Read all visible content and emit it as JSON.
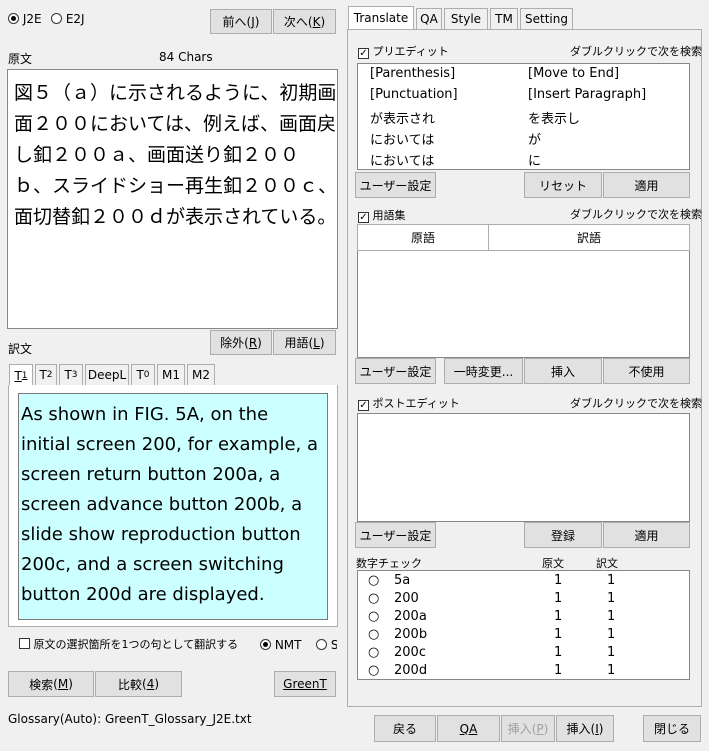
{
  "mode": {
    "j2e": "J2E",
    "e2j": "E2J"
  },
  "nav": {
    "prev": "前へ",
    "prev_key": "J",
    "next": "次へ",
    "next_key": "K"
  },
  "source": {
    "label": "原文",
    "char_count": "84 Chars",
    "lines": [
      "図５（ａ）に示されるように、初期画",
      "面２００においては、例えば、画面戻",
      "し釦２００ａ、画面送り釦２００",
      "ｂ、スライドショー再生釦２００ｃ、画",
      "面切替釦２００ｄが表示されている。"
    ]
  },
  "source_buttons": {
    "exclude": "除外",
    "exclude_key": "R",
    "term": "用語",
    "term_key": "L"
  },
  "target": {
    "label": "訳文",
    "tabs": [
      {
        "main": "T",
        "sub": "1",
        "key_underline": true
      },
      {
        "main": "T",
        "sub": "2",
        "key_underline": false
      },
      {
        "main": "T",
        "sub": "3",
        "key_underline": false
      },
      {
        "main": "DeepL",
        "sub": "",
        "key_underline": false
      },
      {
        "main": "T",
        "sub": "0",
        "key_underline": false
      },
      {
        "main": "M1",
        "sub": "",
        "key_underline": false
      },
      {
        "main": "M2",
        "sub": "",
        "key_underline": false
      }
    ],
    "lines": [
      "As shown in FIG. 5A, on the",
      "initial screen 200, for example, a",
      "screen return button 200a, a",
      "screen advance button 200b, a",
      "slide show reproduction button",
      "200c, and a screen switching",
      "button 200d are displayed."
    ]
  },
  "options": {
    "translate_selection": "原文の選択箇所を1つの句として翻訳する",
    "nmt": "NMT",
    "s": "S"
  },
  "bottom_left": {
    "search": "検索",
    "search_key": "M",
    "compare": "比較",
    "compare_key": "4",
    "greent": "GreenT"
  },
  "status": "Glossary(Auto): GreenT_Glossary_J2E.txt",
  "right_tabs": [
    "Translate",
    "QA",
    "Style",
    "TM",
    "Setting"
  ],
  "pre_edit": {
    "label": "プリエディット",
    "hint": "ダブルクリックで次を検索",
    "rows": [
      {
        "from": "[Parenthesis]",
        "to": "[Move to End]"
      },
      {
        "from": "[Punctuation]",
        "to": "[Insert Paragraph]"
      },
      {
        "from": "が表示され",
        "to": "を表示し"
      },
      {
        "from": "においては",
        "to": "が"
      },
      {
        "from": "においては",
        "to": "に"
      }
    ],
    "user_settings": "ユーザー設定",
    "reset": "リセット",
    "apply": "適用"
  },
  "glossary": {
    "label": "用語集",
    "hint": "ダブルクリックで次を検索",
    "col_source": "原語",
    "col_target": "訳語",
    "user_settings": "ユーザー設定",
    "temp_change": "一時変更...",
    "insert": "挿入",
    "unused": "不使用"
  },
  "post_edit": {
    "label": "ポストエディット",
    "hint": "ダブルクリックで次を検索",
    "user_settings": "ユーザー設定",
    "register": "登録",
    "apply": "適用"
  },
  "number_check": {
    "label": "数字チェック",
    "col_source": "原文",
    "col_target": "訳文",
    "rows": [
      {
        "value": "5a",
        "src": "1",
        "tgt": "1"
      },
      {
        "value": "200",
        "src": "1",
        "tgt": "1"
      },
      {
        "value": "200a",
        "src": "1",
        "tgt": "1"
      },
      {
        "value": "200b",
        "src": "1",
        "tgt": "1"
      },
      {
        "value": "200c",
        "src": "1",
        "tgt": "1"
      },
      {
        "value": "200d",
        "src": "1",
        "tgt": "1"
      }
    ]
  },
  "bottom_right": {
    "back": "戻る",
    "qa": "QA",
    "qa_key": "Q",
    "insert_p": "挿入",
    "insert_p_key": "P",
    "insert_i": "挿入",
    "insert_i_key": "I",
    "close": "閉じる"
  }
}
